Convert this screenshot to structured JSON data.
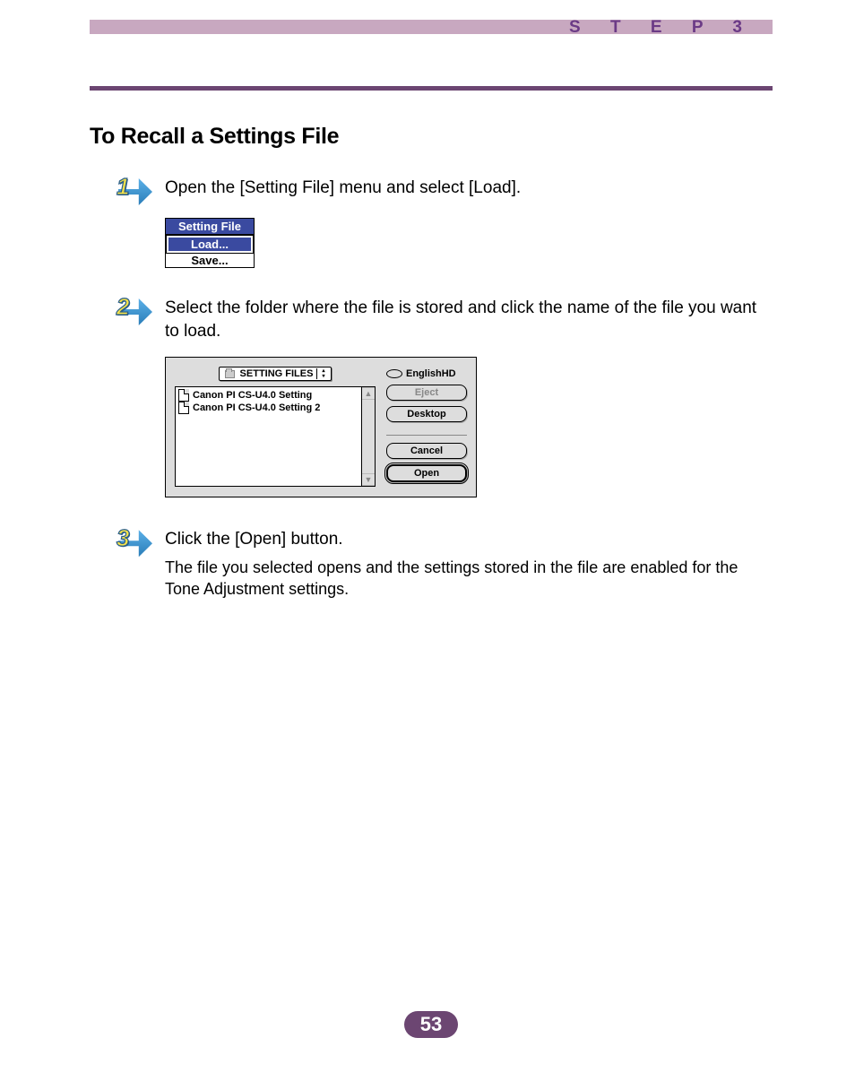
{
  "header": {
    "step_label": "S T E P   3"
  },
  "section": {
    "title": "To Recall a Settings File"
  },
  "steps": [
    {
      "num": "1",
      "text": "Open the [Setting File] menu and select [Load]."
    },
    {
      "num": "2",
      "text": "Select the folder where the file is stored and click the name of the file you want to load."
    },
    {
      "num": "3",
      "text": "Click the [Open] button.",
      "sub": "The file you selected opens and the settings stored in the file are enabled for the Tone Adjustment settings."
    }
  ],
  "menu": {
    "title": "Setting File",
    "items": [
      "Load...",
      "Save..."
    ],
    "selected_index": 0
  },
  "dialog": {
    "popup_label": "SETTING FILES",
    "disk_label": "EnglishHD",
    "files": [
      "Canon PI CS-U4.0 Setting",
      "Canon PI CS-U4.0 Setting 2"
    ],
    "buttons": {
      "eject": "Eject",
      "desktop": "Desktop",
      "cancel": "Cancel",
      "open": "Open"
    }
  },
  "footer": {
    "page": "53"
  }
}
